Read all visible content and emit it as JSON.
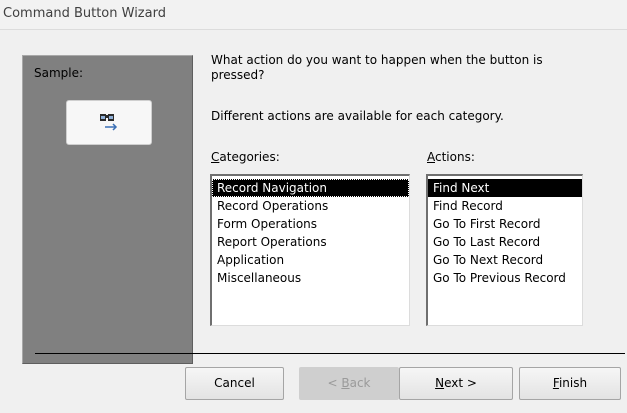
{
  "window": {
    "title": "Command Button Wizard"
  },
  "sample": {
    "label": "Sample:",
    "button_icon": "binoculars-arrow-icon"
  },
  "prompt": {
    "question": "What action do you want to happen when the button is pressed?",
    "info": "Different actions are available for each category."
  },
  "categories": {
    "label_prefix": "",
    "label_key": "C",
    "label_rest": "ategories:",
    "items": [
      "Record Navigation",
      "Record Operations",
      "Form Operations",
      "Report Operations",
      "Application",
      "Miscellaneous"
    ],
    "selected": "Record Navigation"
  },
  "actions": {
    "label_prefix": "",
    "label_key": "A",
    "label_rest": "ctions:",
    "items": [
      "Find Next",
      "Find Record",
      "Go To First Record",
      "Go To Last Record",
      "Go To Next Record",
      "Go To Previous Record"
    ],
    "selected": "Find Next"
  },
  "buttons": {
    "cancel": "Cancel",
    "back_prefix": "< ",
    "back_key": "B",
    "back_rest": "ack",
    "next_key": "N",
    "next_rest": "ext >",
    "finish_key": "F",
    "finish_rest": "inish"
  },
  "colors": {
    "panel": "#808080",
    "selection": "#000000",
    "dialog_bg": "#f0f0f0"
  }
}
